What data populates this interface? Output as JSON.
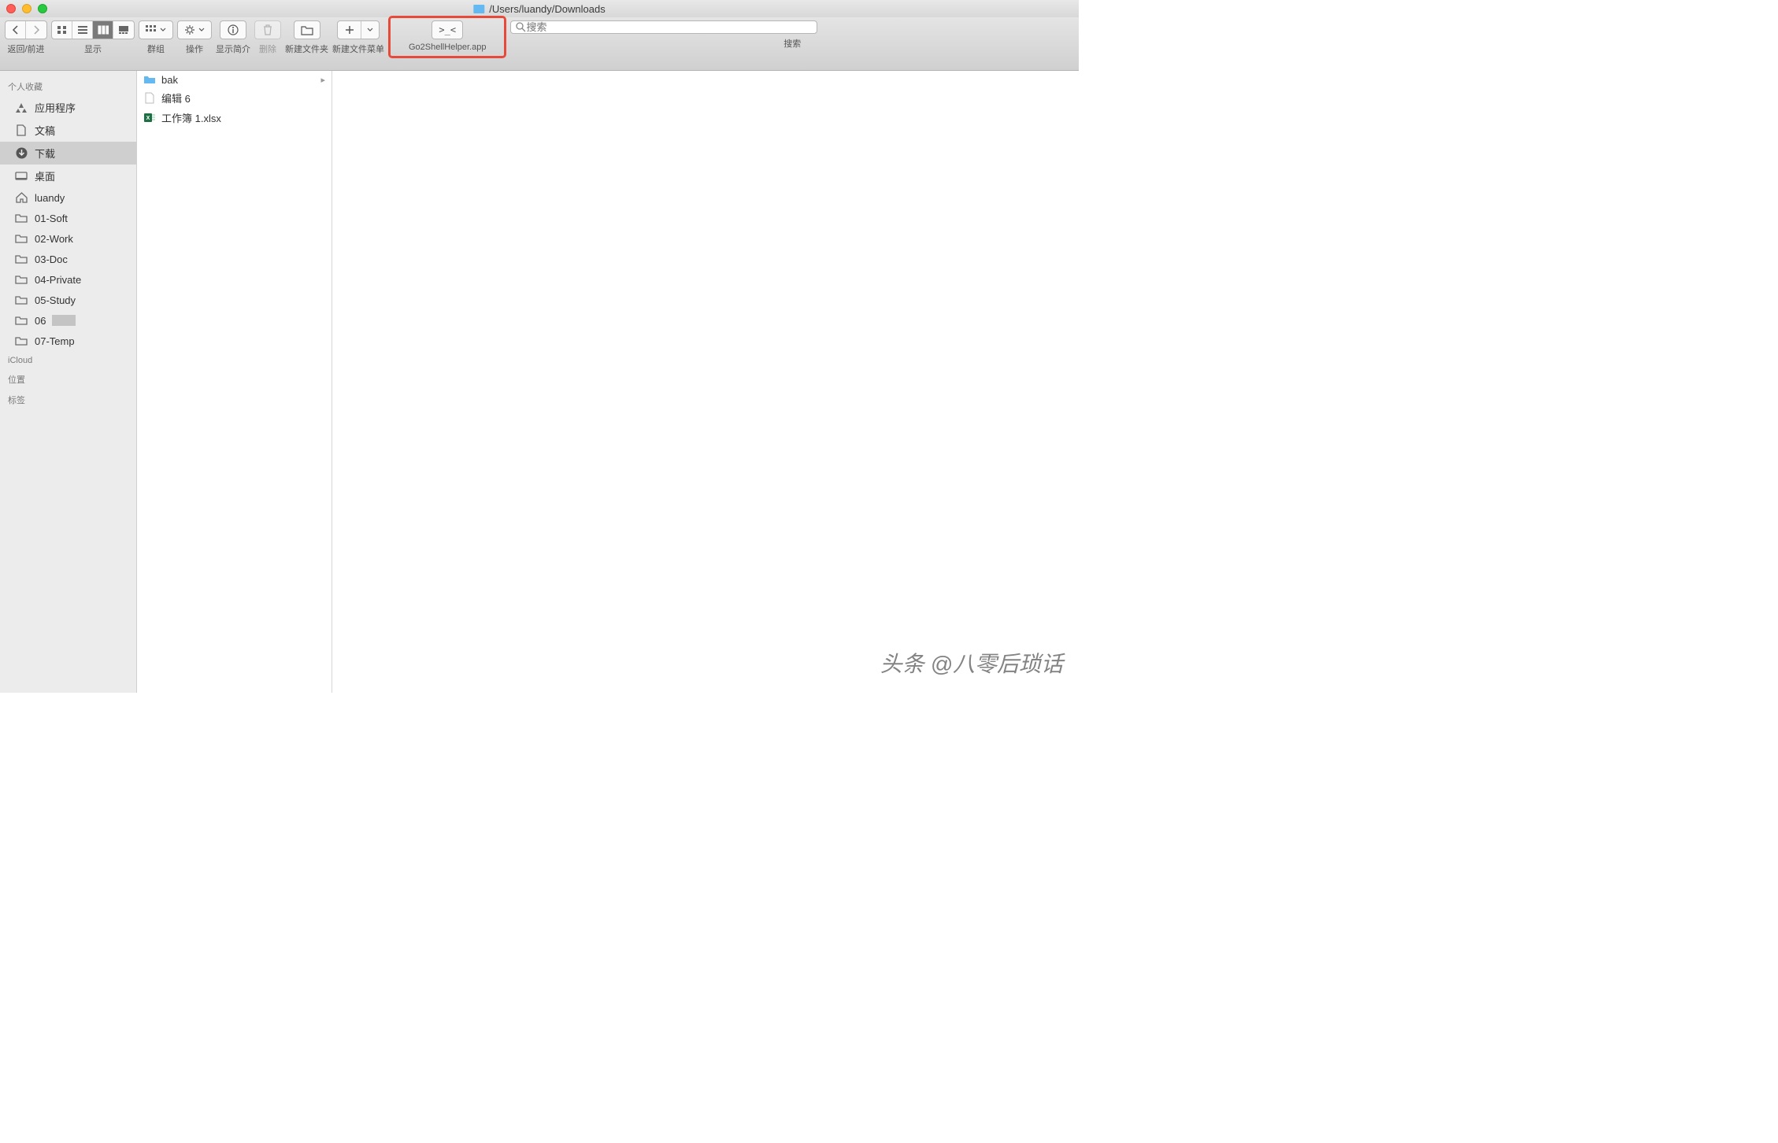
{
  "window": {
    "path": "/Users/luandy/Downloads"
  },
  "toolbar": {
    "nav_label": "返回/前进",
    "view_label": "显示",
    "group_label": "群组",
    "action_label": "操作",
    "info_label": "显示简介",
    "delete_label": "删除",
    "newfolder_label": "新建文件夹",
    "newfilemenu_label": "新建文件菜单",
    "go2shell_label": "Go2ShellHelper.app",
    "search_label": "搜索",
    "search_placeholder": "搜索"
  },
  "sidebar": {
    "sections": {
      "favorites": "个人收藏",
      "icloud": "iCloud",
      "locations": "位置",
      "tags": "标签"
    },
    "items": [
      {
        "label": "应用程序",
        "icon": "apps"
      },
      {
        "label": "文稿",
        "icon": "doc"
      },
      {
        "label": "下载",
        "icon": "download",
        "selected": true
      },
      {
        "label": "桌面",
        "icon": "desktop"
      },
      {
        "label": "luandy",
        "icon": "home"
      },
      {
        "label": "01-Soft",
        "icon": "folder"
      },
      {
        "label": "02-Work",
        "icon": "folder"
      },
      {
        "label": "03-Doc",
        "icon": "folder"
      },
      {
        "label": "04-Private",
        "icon": "folder"
      },
      {
        "label": "05-Study",
        "icon": "folder"
      },
      {
        "label": "06",
        "icon": "folder",
        "redacted": true
      },
      {
        "label": "07-Temp",
        "icon": "folder"
      }
    ]
  },
  "files": [
    {
      "name": "bak",
      "type": "folder"
    },
    {
      "name": "编辑 6",
      "type": "file"
    },
    {
      "name": "工作簿 1.xlsx",
      "type": "xlsx"
    }
  ],
  "watermark": "头条 @八零后琐话"
}
